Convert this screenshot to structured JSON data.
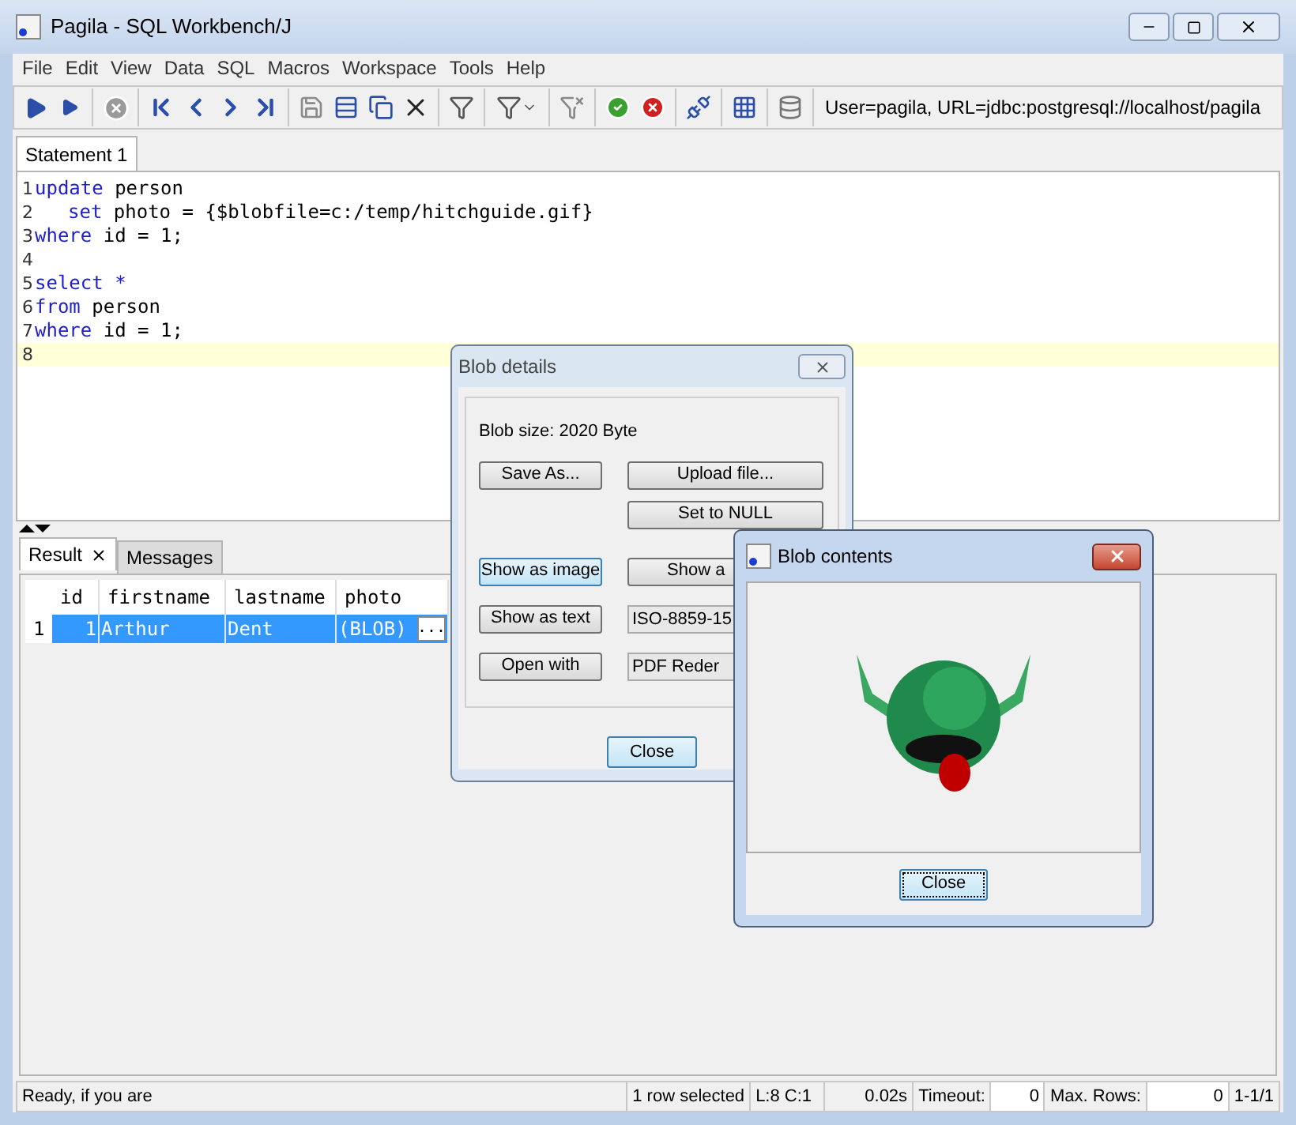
{
  "window": {
    "title": "Pagila - SQL Workbench/J"
  },
  "menu": [
    "File",
    "Edit",
    "View",
    "Data",
    "SQL",
    "Macros",
    "Workspace",
    "Tools",
    "Help"
  ],
  "toolbar": {
    "connection_info": "User=pagila, URL=jdbc:postgresql://localhost/pagila"
  },
  "statement_tabs": [
    {
      "label": "Statement 1",
      "selected": true
    }
  ],
  "editor": {
    "lines": [
      {
        "number": "1",
        "current": false,
        "tokens": [
          {
            "kind": "keyword",
            "text": "update"
          },
          {
            "kind": "plain",
            "text": " person"
          }
        ]
      },
      {
        "number": "2",
        "current": false,
        "indented": true,
        "tokens": [
          {
            "kind": "keyword",
            "text": "set"
          },
          {
            "kind": "plain",
            "text": " photo = {$blobfile=c:/temp/hitchguide.gif}"
          }
        ]
      },
      {
        "number": "3",
        "current": false,
        "tokens": [
          {
            "kind": "keyword",
            "text": "where"
          },
          {
            "kind": "plain",
            "text": " id = 1;"
          }
        ]
      },
      {
        "number": "4",
        "current": false
      },
      {
        "number": "5",
        "current": false,
        "tokens": [
          {
            "kind": "keyword",
            "text": "select *"
          }
        ]
      },
      {
        "number": "6",
        "current": false,
        "tokens": [
          {
            "kind": "keyword",
            "text": "from"
          },
          {
            "kind": "plain",
            "text": " person"
          }
        ]
      },
      {
        "number": "7",
        "current": false,
        "tokens": [
          {
            "kind": "keyword",
            "text": "where"
          },
          {
            "kind": "plain",
            "text": " id = 1;"
          }
        ]
      },
      {
        "number": "8",
        "current": true
      }
    ]
  },
  "result_tabs": [
    {
      "label": "Result",
      "closable": true,
      "selected": true
    },
    {
      "label": "Messages",
      "closable": false,
      "selected": false
    }
  ],
  "table": {
    "columns": [
      "id",
      "firstname",
      "lastname",
      "photo"
    ],
    "rows": [
      {
        "row_number": "1",
        "selected": true,
        "cells": [
          "1",
          "Arthur",
          "Dent",
          "(BLOB)"
        ],
        "cell_button": "..."
      }
    ]
  },
  "status_bar": {
    "message": "Ready, if you are",
    "selection": "1 row selected",
    "position": "L:8 C:1",
    "time": "0.02s",
    "timeout_label": "Timeout:",
    "timeout_value": "0",
    "max_rows_label": "Max. Rows:",
    "max_rows_value": "0",
    "row_range": "1-1/1"
  },
  "blob_details": {
    "title": "Blob details",
    "size": "Blob size: 2020 Byte",
    "save_as": "Save As...",
    "upload": "Upload file...",
    "set_null": "Set to NULL",
    "show_image": {
      "label": "Show as image",
      "focused": true
    },
    "show_other": "Show a",
    "show_text": "Show as text",
    "encoding": "ISO-8859-15",
    "open_with": "Open with",
    "app": "PDF Reder",
    "close": "Close"
  },
  "blob_contents": {
    "title": "Blob contents",
    "close": "Close"
  }
}
